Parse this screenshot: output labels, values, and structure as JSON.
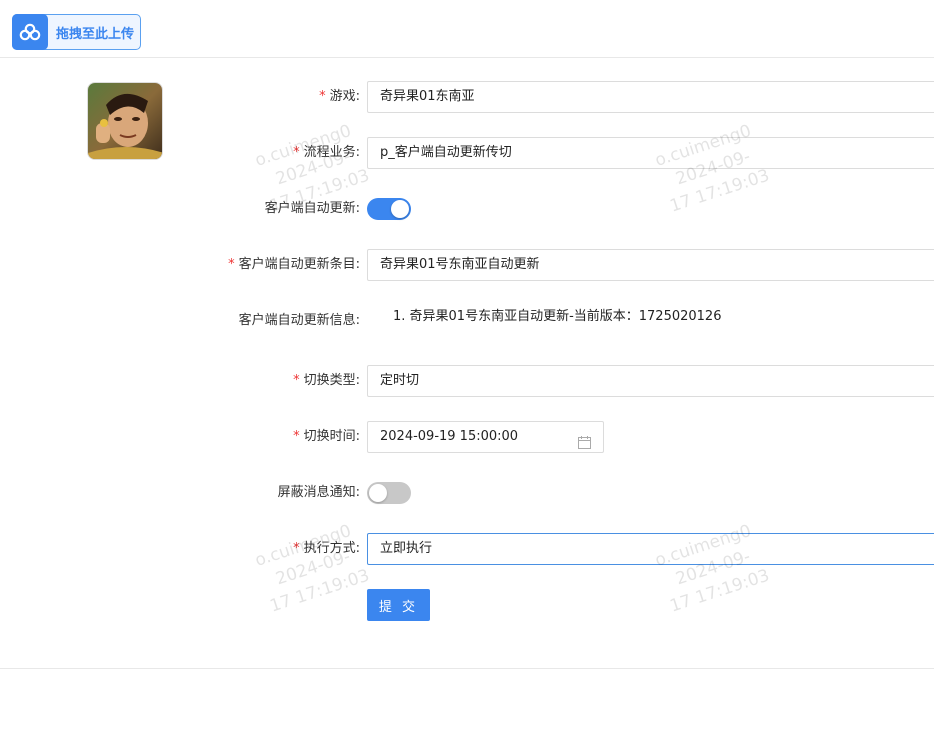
{
  "upload": {
    "label": "拖拽至此上传",
    "icon": "cloud-link-icon"
  },
  "form": {
    "game": {
      "label": "游戏:",
      "value": "奇异果01东南亚",
      "required": true
    },
    "business": {
      "label": "流程业务:",
      "value": "p_客户端自动更新传切",
      "required": true
    },
    "auto_update": {
      "label": "客户端自动更新:",
      "on": true
    },
    "update_item": {
      "label": "客户端自动更新条目:",
      "value": "奇异果01号东南亚自动更新",
      "required": true
    },
    "update_info": {
      "label": "客户端自动更新信息:",
      "text": "1. 奇异果01号东南亚自动更新-当前版本：1725020126"
    },
    "switch_type": {
      "label": "切换类型:",
      "value": "定时切",
      "required": true
    },
    "switch_time": {
      "label": "切换时间:",
      "value": "2024-09-19 15:00:00",
      "required": true,
      "icon": "calendar-icon"
    },
    "mute_notify": {
      "label": "屏蔽消息通知:",
      "on": false
    },
    "exec_mode": {
      "label": "执行方式:",
      "value": "立即执行",
      "required": true
    },
    "submit_label": "提 交"
  },
  "watermark": {
    "line1": "o.cuimeng0",
    "line2": "2024-09-",
    "line3": "17 17:19:03"
  },
  "colors": {
    "accent": "#3b86ef",
    "required": "#e33333",
    "toggle_off": "#c8c8c8"
  }
}
